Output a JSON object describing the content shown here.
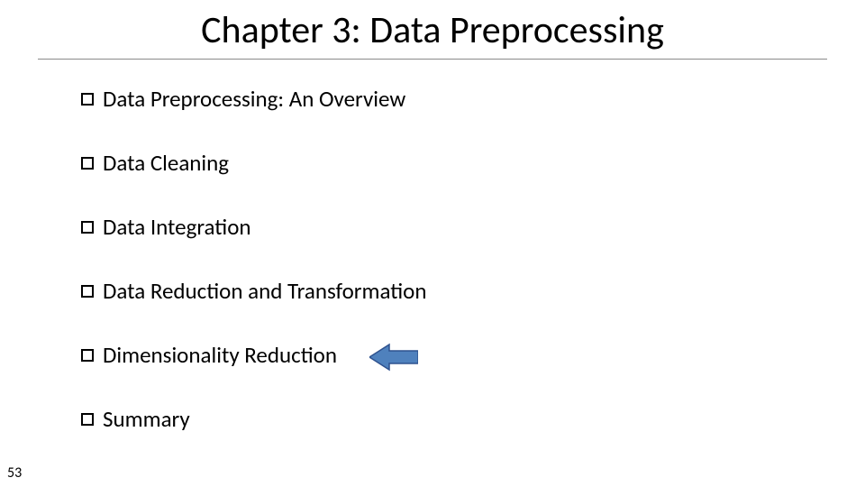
{
  "title": "Chapter 3: Data Preprocessing",
  "items": [
    "Data Preprocessing: An Overview",
    "Data Cleaning",
    "Data Integration",
    "Data Reduction and Transformation",
    "Dimensionality Reduction",
    "Summary"
  ],
  "page_number": "53",
  "arrow_target_index": 4
}
